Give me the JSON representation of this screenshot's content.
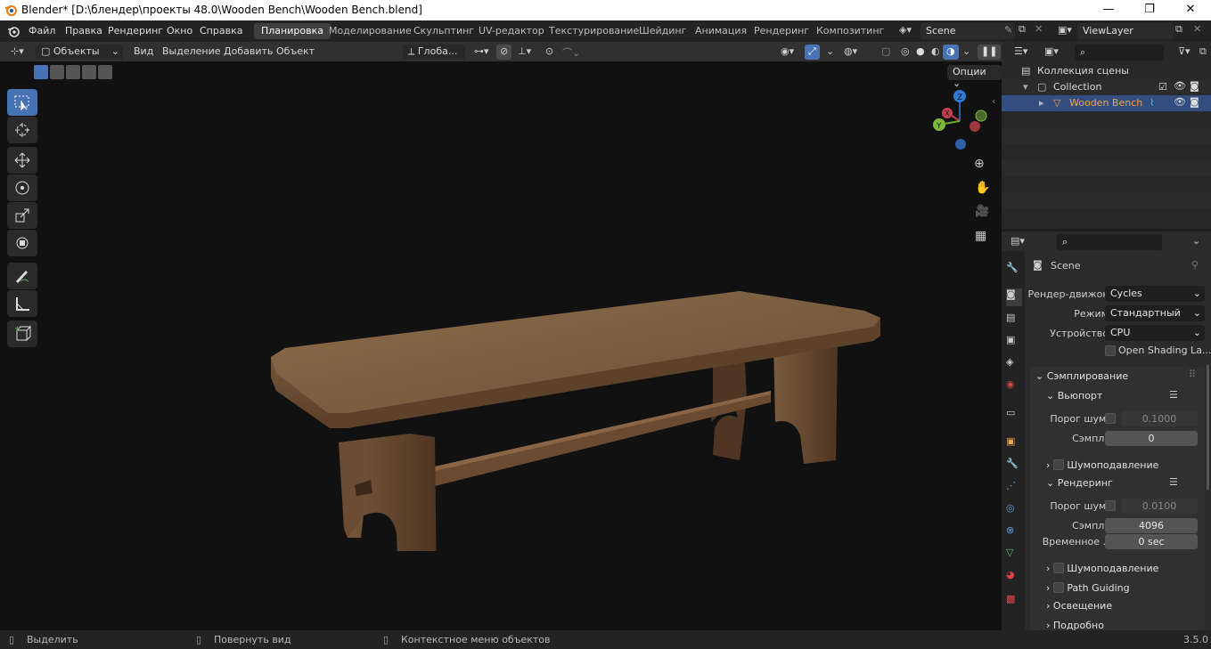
{
  "window": {
    "title": "Blender* [D:\\блендер\\проекты 48.0\\Wooden Bench\\Wooden Bench.blend]",
    "minimize": "—",
    "maximize": "❐",
    "close": "✕"
  },
  "menu": {
    "items": [
      "Файл",
      "Правка",
      "Рендеринг",
      "Окно",
      "Справка"
    ],
    "workspaces": [
      "Планировка",
      "Моделирование",
      "Скульптинг",
      "UV-редактор",
      "Текстурирование",
      "Шейдинг",
      "Анимация",
      "Рендеринг",
      "Композитинг"
    ],
    "active_workspace": "Планировка",
    "scene": "Scene",
    "view_layer": "ViewLayer"
  },
  "viewport_header": {
    "mode": "Объекты",
    "menus": [
      "Вид",
      "Выделение",
      "Добавить",
      "Объект"
    ],
    "orientation": "Глоба...",
    "options": "Опции"
  },
  "toolbar": {
    "tools": [
      "select-box-tool",
      "cursor-tool",
      "move-tool",
      "rotate-tool",
      "scale-tool",
      "transform-tool",
      "annotate-tool",
      "measure-tool",
      "add-cube-tool"
    ]
  },
  "gizmo": {
    "x": "X",
    "y": "Y",
    "z": "Z"
  },
  "outliner": {
    "scene_collection": "Коллекция сцены",
    "collection": "Collection",
    "object": "Wooden Bench"
  },
  "properties": {
    "scene_label": "Scene",
    "render_engine_label": "Рендер-движок",
    "render_engine": "Cycles",
    "mode_label": "Режим",
    "mode": "Стандартный",
    "device_label": "Устройство",
    "device": "CPU",
    "osl": "Open Shading La...",
    "sampling": "Сэмплирование",
    "viewport": "Вьюпорт",
    "noise_threshold_label": "Порог шума",
    "viewport_noise": "0.1000",
    "samples_label": "Сэмплы",
    "viewport_samples": "0",
    "denoise": "Шумоподавление",
    "render": "Рендеринг",
    "render_noise": "0.0100",
    "render_samples": "4096",
    "time_limit_label": "Временное ...",
    "time_limit": "0 sec",
    "path_guiding": "Path Guiding",
    "lighting": "Освещение",
    "advanced": "Подробно"
  },
  "status": {
    "select": "Выделить",
    "rotate": "Повернуть вид",
    "context": "Контекстное меню объектов",
    "version": "3.5.0"
  }
}
